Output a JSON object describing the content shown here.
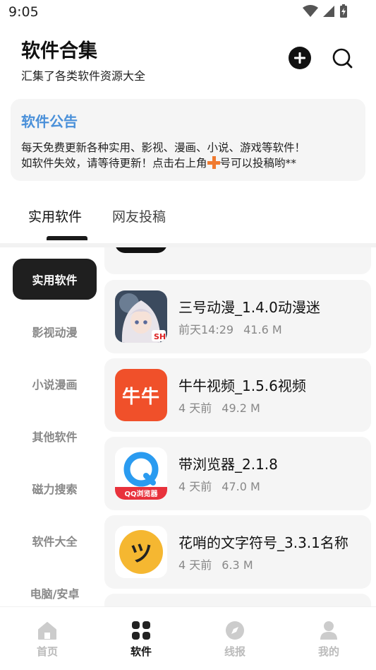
{
  "status_bar": {
    "time": "9:05"
  },
  "header": {
    "title": "软件合集",
    "subtitle": "汇集了各类软件资源大全"
  },
  "notice": {
    "title": "软件公告",
    "line1": "每天免费更新各种实用、影视、漫画、小说、游戏等软件！",
    "line2_before": "如软件失效，请等待更新！点击右上角",
    "line2_after": "号可以投稿哟**"
  },
  "tabs": [
    {
      "label": "实用软件",
      "active": true
    },
    {
      "label": "网友投稿",
      "active": false
    }
  ],
  "categories": [
    {
      "label": "实用软件",
      "active": true
    },
    {
      "label": "影视动漫",
      "active": false
    },
    {
      "label": "小说漫画",
      "active": false
    },
    {
      "label": "其他软件",
      "active": false
    },
    {
      "label": "磁力搜索",
      "active": false
    },
    {
      "label": "软件大全",
      "active": false
    },
    {
      "label": "电脑/安卓",
      "active": false
    }
  ],
  "apps": [
    {
      "name": "三号动漫_1.4.0动漫迷",
      "time": "前天14:29",
      "size": "41.6 M",
      "icon": "anime-girl-icon"
    },
    {
      "name": "牛牛视频_1.5.6视频",
      "time": "4 天前",
      "size": "49.2 M",
      "icon": "niuniu-icon",
      "icon_text": "牛牛"
    },
    {
      "name": "带浏览器_2.1.8",
      "time": "4 天前",
      "size": "47.0 M",
      "icon": "qq-browser-icon",
      "icon_text": "QQ浏览器"
    },
    {
      "name": "花哨的文字符号_3.3.1名称",
      "time": "4 天前",
      "size": "6.3 M",
      "icon": "smiley-icon",
      "icon_text": "ツ"
    }
  ],
  "bottom_nav": [
    {
      "label": "首页",
      "icon": "home-icon",
      "active": false
    },
    {
      "label": "软件",
      "icon": "grid-icon",
      "active": true
    },
    {
      "label": "线报",
      "icon": "compass-icon",
      "active": false
    },
    {
      "label": "我的",
      "icon": "user-icon",
      "active": false
    }
  ],
  "colors": {
    "accent": "#4a90d9",
    "plus": "#f07a2f",
    "niuniu_bg": "#f0502a",
    "smiley_bg": "#f5b731"
  }
}
